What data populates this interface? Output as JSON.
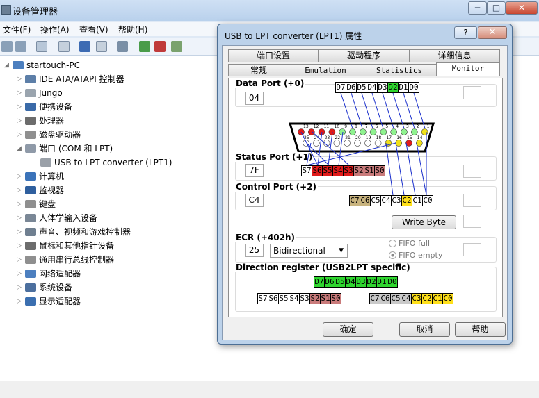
{
  "window": {
    "title": "设备管理器",
    "controls": {
      "minimize": "─",
      "maximize": "□",
      "close": "✕"
    }
  },
  "menu": [
    "文件(F)",
    "操作(A)",
    "查看(V)",
    "帮助(H)"
  ],
  "tree": {
    "root": "startouch-PC",
    "items": [
      {
        "label": "IDE ATA/ATAPI 控制器",
        "icon": "ide-controller-icon"
      },
      {
        "label": "Jungo",
        "icon": "device-icon"
      },
      {
        "label": "便携设备",
        "icon": "portable-device-icon"
      },
      {
        "label": "处理器",
        "icon": "processor-icon"
      },
      {
        "label": "磁盘驱动器",
        "icon": "disk-drive-icon"
      },
      {
        "label": "端口 (COM 和 LPT)",
        "icon": "port-icon",
        "expanded": true
      },
      {
        "label": "USB to LPT converter (LPT1)",
        "icon": "port-icon",
        "child": true
      },
      {
        "label": "计算机",
        "icon": "computer-icon"
      },
      {
        "label": "监视器",
        "icon": "monitor-icon"
      },
      {
        "label": "键盘",
        "icon": "keyboard-icon"
      },
      {
        "label": "人体学输入设备",
        "icon": "hid-icon"
      },
      {
        "label": "声音、视频和游戏控制器",
        "icon": "sound-icon"
      },
      {
        "label": "鼠标和其他指针设备",
        "icon": "mouse-icon"
      },
      {
        "label": "通用串行总线控制器",
        "icon": "usb-icon"
      },
      {
        "label": "网络适配器",
        "icon": "network-icon"
      },
      {
        "label": "系统设备",
        "icon": "system-icon"
      },
      {
        "label": "显示适配器",
        "icon": "display-adapter-icon"
      }
    ]
  },
  "dialog": {
    "title": "USB to LPT converter (LPT1) 属性",
    "help": "?",
    "close": "✕",
    "tabs_back": [
      "端口设置",
      "驱动程序",
      "详细信息"
    ],
    "tabs_front": [
      "常规",
      "Emulation",
      "Statistics",
      "Monitor"
    ],
    "active_tab": "Monitor",
    "data_port": {
      "label": "Data Port (+0)",
      "value": "04",
      "bits": [
        {
          "t": "D7",
          "c": "white"
        },
        {
          "t": "D6",
          "c": "white"
        },
        {
          "t": "D5",
          "c": "white"
        },
        {
          "t": "D4",
          "c": "white"
        },
        {
          "t": "D3",
          "c": "white"
        },
        {
          "t": "D2",
          "c": "green"
        },
        {
          "t": "D1",
          "c": "white"
        },
        {
          "t": "D0",
          "c": "white"
        }
      ]
    },
    "connector": {
      "top_pins": [
        "13",
        "12",
        "11",
        "10",
        "9",
        "8",
        "7",
        "6",
        "5",
        "4",
        "3",
        "2",
        "1"
      ],
      "bottom_pins": [
        "25",
        "24",
        "23",
        "22",
        "21",
        "20",
        "19",
        "18",
        "17",
        "16",
        "15",
        "14"
      ],
      "top_colors": [
        "red",
        "red",
        "red",
        "red",
        "green",
        "green",
        "green",
        "green",
        "green",
        "green",
        "green",
        "green",
        "yellow"
      ],
      "bottom_colors": [
        "white",
        "white",
        "white",
        "white",
        "white",
        "white",
        "white",
        "white",
        "yellow",
        "yellow",
        "red",
        "yellow"
      ]
    },
    "status_port": {
      "label": "Status Port (+1)",
      "value": "7F",
      "bits": [
        {
          "t": "S7",
          "c": "white"
        },
        {
          "t": "S6",
          "c": "red"
        },
        {
          "t": "S5",
          "c": "red"
        },
        {
          "t": "S4",
          "c": "red"
        },
        {
          "t": "S3",
          "c": "red"
        },
        {
          "t": "S2",
          "c": "rose"
        },
        {
          "t": "S1",
          "c": "rose"
        },
        {
          "t": "S0",
          "c": "rose"
        }
      ]
    },
    "control_port": {
      "label": "Control Port (+2)",
      "value": "C4",
      "bits": [
        {
          "t": "C7",
          "c": "khaki"
        },
        {
          "t": "C6",
          "c": "khaki"
        },
        {
          "t": "C5",
          "c": "white"
        },
        {
          "t": "C4",
          "c": "white"
        },
        {
          "t": "C3",
          "c": "white"
        },
        {
          "t": "C2",
          "c": "yellow"
        },
        {
          "t": "C1",
          "c": "white"
        },
        {
          "t": "C0",
          "c": "white"
        }
      ]
    },
    "write_byte": "Write Byte",
    "ecr": {
      "label": "ECR (+402h)",
      "value": "25",
      "mode": "Bidirectional",
      "fifo_full": "FIFO full",
      "fifo_empty": "FIFO empty"
    },
    "direction": {
      "label": "Direction register (USB2LPT specific)",
      "data_bits": [
        {
          "t": "D7",
          "c": "green"
        },
        {
          "t": "D6",
          "c": "green"
        },
        {
          "t": "D5",
          "c": "green"
        },
        {
          "t": "D4",
          "c": "green"
        },
        {
          "t": "D3",
          "c": "green"
        },
        {
          "t": "D2",
          "c": "green"
        },
        {
          "t": "D1",
          "c": "green"
        },
        {
          "t": "D0",
          "c": "green"
        }
      ],
      "status_bits": [
        {
          "t": "S7",
          "c": "white"
        },
        {
          "t": "S6",
          "c": "white"
        },
        {
          "t": "S5",
          "c": "white"
        },
        {
          "t": "S4",
          "c": "white"
        },
        {
          "t": "S3",
          "c": "white"
        },
        {
          "t": "S2",
          "c": "rose"
        },
        {
          "t": "S1",
          "c": "rose"
        },
        {
          "t": "S0",
          "c": "rose"
        }
      ],
      "control_bits": [
        {
          "t": "C7",
          "c": "gray"
        },
        {
          "t": "C6",
          "c": "gray"
        },
        {
          "t": "C5",
          "c": "gray"
        },
        {
          "t": "C4",
          "c": "gray"
        },
        {
          "t": "C3",
          "c": "yellow"
        },
        {
          "t": "C2",
          "c": "yellow"
        },
        {
          "t": "C1",
          "c": "yellow"
        },
        {
          "t": "C0",
          "c": "yellow"
        }
      ]
    },
    "ok": "确定",
    "cancel": "取消",
    "help_btn": "帮助"
  }
}
